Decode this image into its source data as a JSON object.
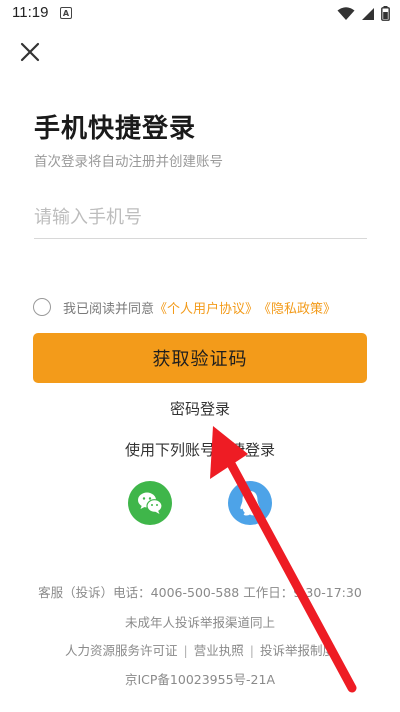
{
  "status_bar": {
    "time": "11:19",
    "notification_badge": "A"
  },
  "header": {
    "title": "手机快捷登录",
    "subtitle": "首次登录将自动注册并创建账号"
  },
  "phone_input": {
    "placeholder": "请输入手机号",
    "value": ""
  },
  "agreement": {
    "checked": false,
    "prefix": "我已阅读并同意",
    "user_agreement": "《个人用户协议》",
    "privacy_policy": "《隐私政策》"
  },
  "actions": {
    "get_code_label": "获取验证码",
    "password_login_label": "密码登录"
  },
  "other_login": {
    "title": "使用下列账号快捷登录",
    "providers": [
      "wechat-icon",
      "qq-icon"
    ]
  },
  "footer": {
    "service_line": "客服（投诉）电话：4006-500-588 工作日：9:30-17:30",
    "minor_line": "未成年人投诉举报渠道同上",
    "links": [
      "人力资源服务许可证",
      "营业执照",
      "投诉举报制度"
    ],
    "link_separator": "|",
    "icp": "京ICP备10023955号-21A"
  },
  "colors": {
    "accent": "#f39b1a",
    "wechat": "#3fb64a",
    "qq": "#4da3e8",
    "annotation": "#ee1c24"
  }
}
